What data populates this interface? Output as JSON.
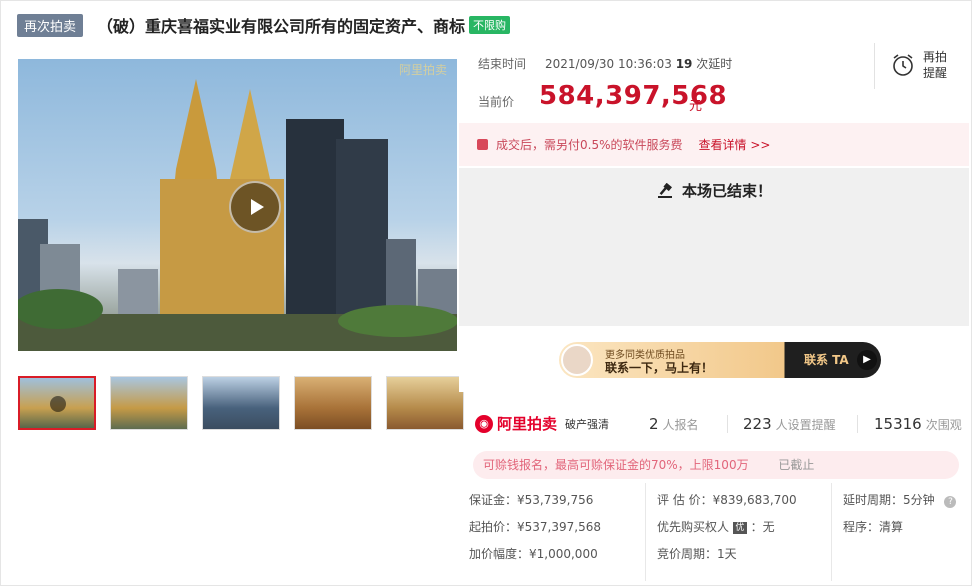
{
  "header": {
    "resale_tag": "再次拍卖",
    "title": "（破）重庆喜福实业有限公司所有的固定资产、商标",
    "unlimited_tag": "不限购"
  },
  "media": {
    "watermark": "阿里拍卖",
    "thumbnails": [
      "缩略图1",
      "缩略图2",
      "缩略图3",
      "缩略图4",
      "缩略图5"
    ]
  },
  "auction": {
    "end_time_label": "结束时间",
    "end_time": "2021/09/30 10:36:03",
    "delay_count": "19",
    "delay_suffix": "次延时",
    "current_price_label": "当前价",
    "current_price": "584,397,568",
    "price_unit": "元",
    "remind_label": "再拍提醒"
  },
  "fee_notice": {
    "text": "成交后，需另付0.5%的软件服务费",
    "link": "查看详情 >>"
  },
  "status": {
    "ended_text": "本场已结束！"
  },
  "promo": {
    "small_text": "更多同类优质拍品",
    "big_text": "联系一下，马上有！",
    "button": "联系 TA"
  },
  "stats": {
    "logo_text": "阿里拍卖",
    "logo_sub": "破产强清",
    "signups": "2",
    "signups_label": "人报名",
    "reminders": "223",
    "reminders_label": "人设置提醒",
    "views": "15316",
    "views_label": "次围观"
  },
  "deposit_notice": {
    "text": "可赊钱报名，最高可赊保证金的70%，上限100万",
    "status": "已截止"
  },
  "params": {
    "deposit": "保证金：¥53,739,756",
    "start_price": "起拍价：¥537,397,568",
    "increment": "加价幅度：¥1,000,000",
    "valuation": "评 估 价：¥839,683,700",
    "priority_label": "优先购买权人",
    "priority_icon": "优",
    "priority_value": "：无",
    "bid_period": "竞价周期：1天",
    "delay_period": "延时周期：5分钟",
    "help_icon": "?",
    "procedure": "程序：清算"
  },
  "colors": {
    "price_red": "#c9132a",
    "tag_green": "#28b663",
    "tag_gray": "#6f7f95"
  }
}
